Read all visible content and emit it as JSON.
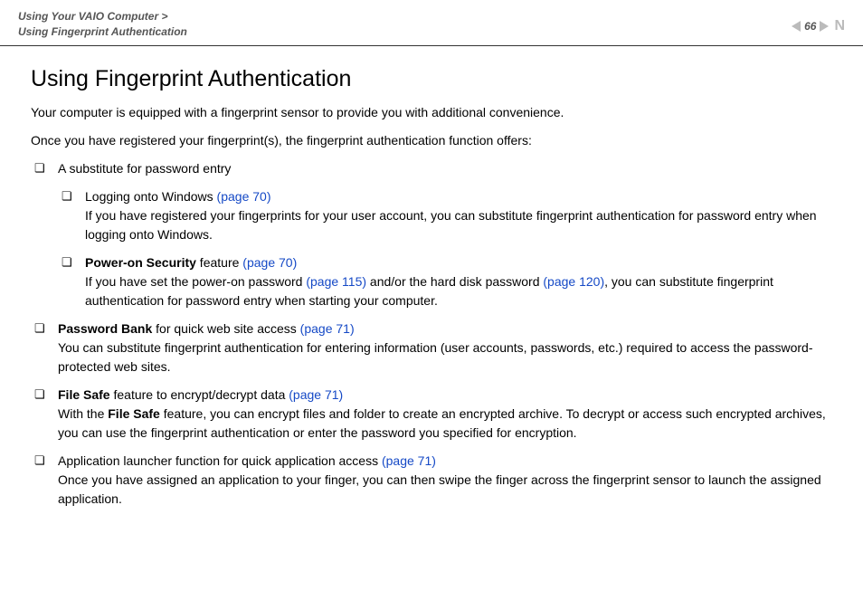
{
  "header": {
    "breadcrumb_line1": "Using Your VAIO Computer >",
    "breadcrumb_line2": "Using Fingerprint Authentication",
    "page_number": "66",
    "n_label": "N"
  },
  "page": {
    "title": "Using Fingerprint Authentication",
    "intro1": "Your computer is equipped with a fingerprint sensor to provide you with additional convenience.",
    "intro2": "Once you have registered your fingerprint(s), the fingerprint authentication function offers:"
  },
  "bullets": {
    "b1": "A substitute for password entry",
    "b1_1_a": "Logging onto Windows ",
    "b1_1_link": "(page 70)",
    "b1_1_b": "If you have registered your fingerprints for your user account, you can substitute fingerprint authentication for password entry when logging onto Windows.",
    "b1_2_bold": "Power-on Security",
    "b1_2_a": " feature ",
    "b1_2_link": "(page 70)",
    "b1_2_b_pre": "If you have set the power-on password ",
    "b1_2_link2": "(page 115)",
    "b1_2_b_mid": " and/or the hard disk password ",
    "b1_2_link3": "(page 120)",
    "b1_2_b_post": ", you can substitute fingerprint authentication for password entry when starting your computer.",
    "b2_bold": "Password Bank",
    "b2_a": " for quick web site access ",
    "b2_link": "(page 71)",
    "b2_b": "You can substitute fingerprint authentication for entering information (user accounts, passwords, etc.) required to access the password-protected web sites.",
    "b3_bold": "File Safe",
    "b3_a": " feature to encrypt/decrypt data ",
    "b3_link": "(page 71)",
    "b3_b_pre": "With the ",
    "b3_b_bold": "File Safe",
    "b3_b_post": " feature, you can encrypt files and folder to create an encrypted archive. To decrypt or access such encrypted archives, you can use the fingerprint authentication or enter the password you specified for encryption.",
    "b4_a": "Application launcher function for quick application access ",
    "b4_link": "(page 71)",
    "b4_b": "Once you have assigned an application to your finger, you can then swipe the finger across the fingerprint sensor to launch the assigned application."
  }
}
